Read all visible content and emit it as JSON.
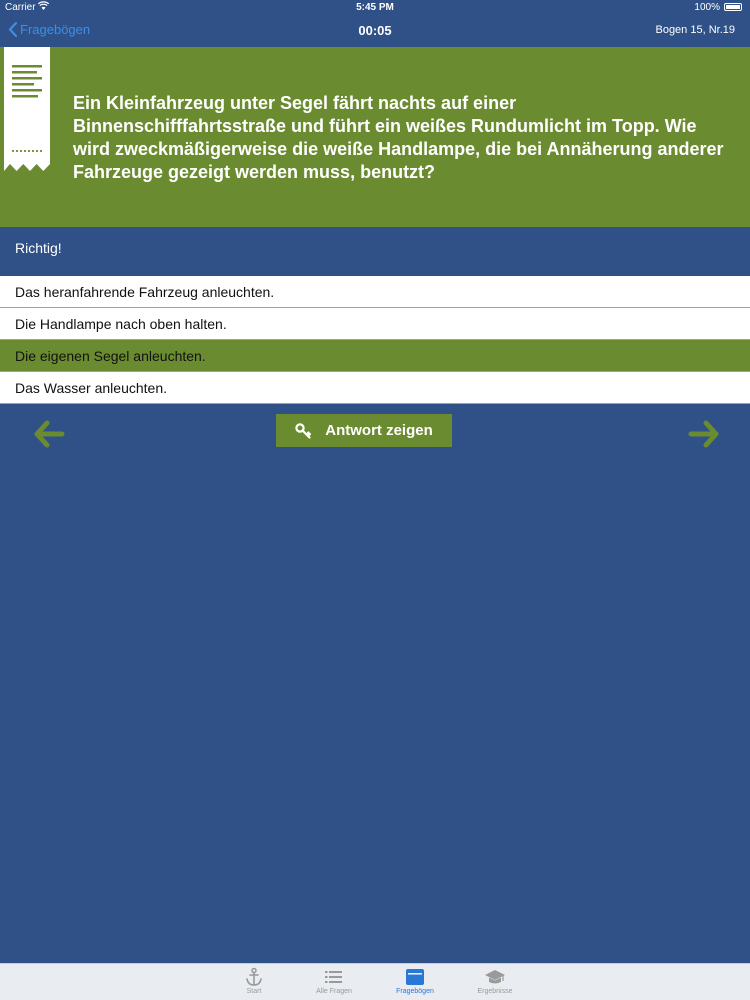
{
  "status": {
    "carrier": "Carrier",
    "time": "5:45 PM",
    "battery": "100%"
  },
  "nav": {
    "back_label": "Fragebögen",
    "timer": "00:05",
    "sheet_info": "Bogen 15, Nr.19"
  },
  "question": {
    "text": "Ein Kleinfahrzeug unter Segel fährt nachts auf einer Binnenschifffahrtsstraße und führt ein weißes Rundumlicht im Topp. Wie wird zweckmäßigerweise die weiße Handlampe, die bei Annäherung anderer Fahrzeuge gezeigt werden muss, benutzt?"
  },
  "feedback": "Richtig!",
  "answers": [
    {
      "label": "Das heranfahrende Fahrzeug anleuchten.",
      "selected": false
    },
    {
      "label": "Die Handlampe nach oben halten.",
      "selected": false
    },
    {
      "label": "Die eigenen Segel anleuchten.",
      "selected": true
    },
    {
      "label": "Das Wasser anleuchten.",
      "selected": false
    }
  ],
  "show_answer_label": "Antwort zeigen",
  "tabs": [
    {
      "label": "Start",
      "icon": "anchor-icon",
      "active": false
    },
    {
      "label": "Alle Fragen",
      "icon": "list-icon",
      "active": false
    },
    {
      "label": "Fragebögen",
      "icon": "folder-icon",
      "active": true
    },
    {
      "label": "Ergebnisse",
      "icon": "graduation-cap-icon",
      "active": false
    }
  ],
  "colors": {
    "background": "#2f5187",
    "accent_green": "#6b8b31",
    "tab_active": "#2a78d6",
    "back_link": "#3d8ee5"
  }
}
